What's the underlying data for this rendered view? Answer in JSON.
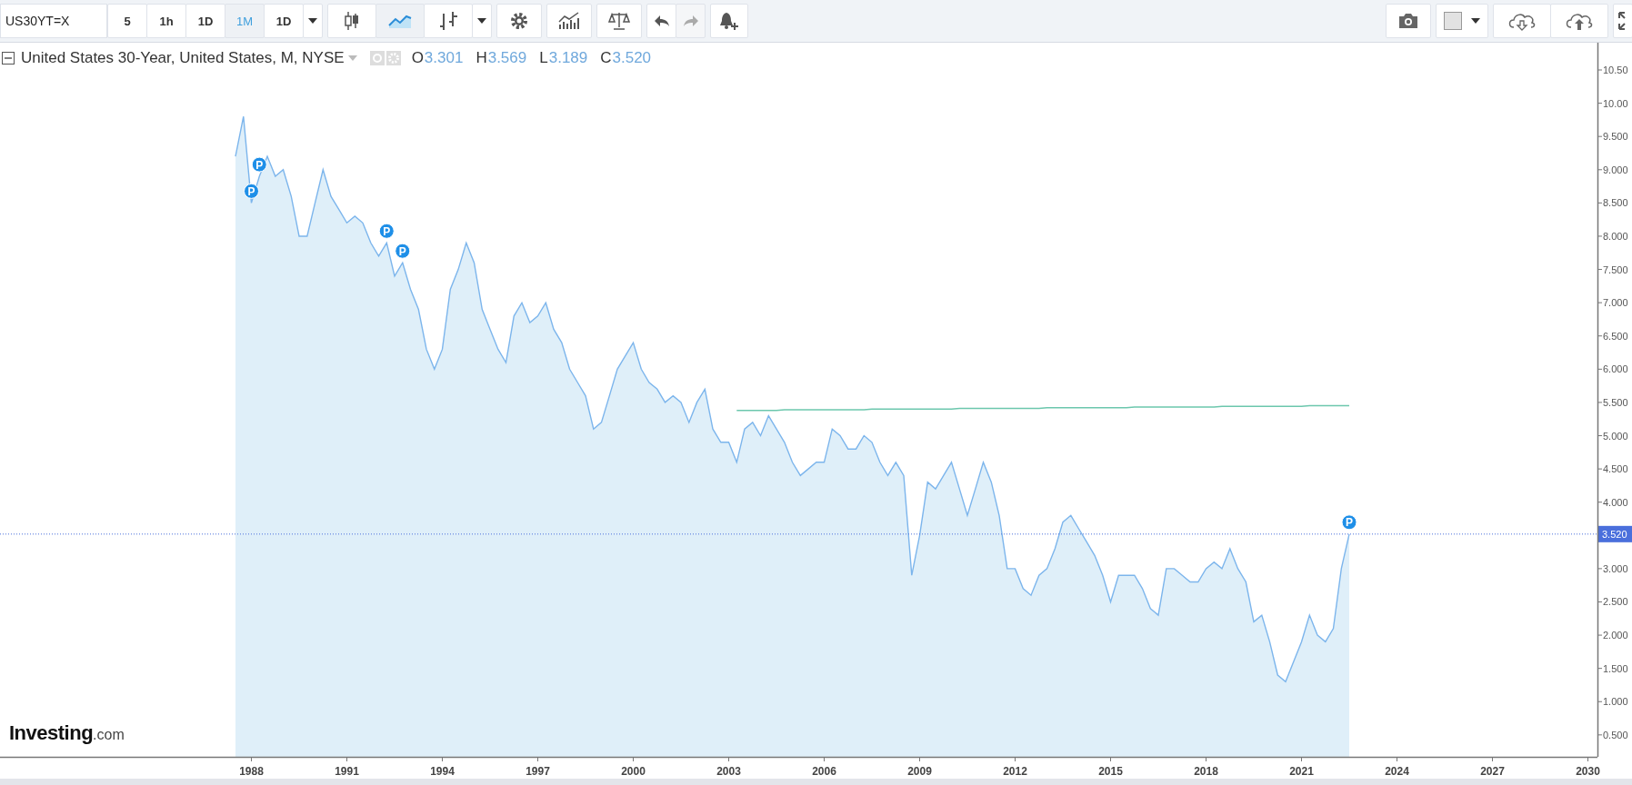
{
  "toolbar": {
    "symbol": "US30YT=X",
    "intervals": [
      {
        "label": "5",
        "selected": false
      },
      {
        "label": "1h",
        "selected": false
      },
      {
        "label": "1D",
        "selected": false
      },
      {
        "label": "1M",
        "selected": true
      },
      {
        "label": "1D",
        "selected": false
      }
    ],
    "chart_types": [
      {
        "kind": "candles",
        "selected": false
      },
      {
        "kind": "line",
        "selected": true
      },
      {
        "kind": "bars",
        "selected": false
      }
    ]
  },
  "legend": {
    "title": "United States 30-Year, United States, M, NYSE",
    "ohlc": [
      {
        "label": "O",
        "value": "3.301"
      },
      {
        "label": "H",
        "value": "3.569"
      },
      {
        "label": "L",
        "value": "3.189"
      },
      {
        "label": "C",
        "value": "3.520"
      }
    ]
  },
  "logo": {
    "name": "Investing",
    "suffix": ".com"
  },
  "chart_data": {
    "type": "area",
    "x": [
      1987.5,
      1987.75,
      1988,
      1988.25,
      1988.5,
      1988.75,
      1989,
      1989.25,
      1989.5,
      1989.75,
      1990,
      1990.25,
      1990.5,
      1990.75,
      1991,
      1991.25,
      1991.5,
      1991.75,
      1992,
      1992.25,
      1992.5,
      1992.75,
      1993,
      1993.25,
      1993.5,
      1993.75,
      1994,
      1994.25,
      1994.5,
      1994.75,
      1995,
      1995.25,
      1995.5,
      1995.75,
      1996,
      1996.25,
      1996.5,
      1996.75,
      1997,
      1997.25,
      1997.5,
      1997.75,
      1998,
      1998.25,
      1998.5,
      1998.75,
      1999,
      1999.25,
      1999.5,
      1999.75,
      2000,
      2000.25,
      2000.5,
      2000.75,
      2001,
      2001.25,
      2001.5,
      2001.75,
      2002,
      2002.25,
      2002.5,
      2002.75,
      2003,
      2003.25,
      2003.5,
      2003.75,
      2004,
      2004.25,
      2004.5,
      2004.75,
      2005,
      2005.25,
      2005.5,
      2005.75,
      2006,
      2006.25,
      2006.5,
      2006.75,
      2007,
      2007.25,
      2007.5,
      2007.75,
      2008,
      2008.25,
      2008.5,
      2008.75,
      2009,
      2009.25,
      2009.5,
      2009.75,
      2010,
      2010.25,
      2010.5,
      2010.75,
      2011,
      2011.25,
      2011.5,
      2011.75,
      2012,
      2012.25,
      2012.5,
      2012.75,
      2013,
      2013.25,
      2013.5,
      2013.75,
      2014,
      2014.25,
      2014.5,
      2014.75,
      2015,
      2015.25,
      2015.5,
      2015.75,
      2016,
      2016.25,
      2016.5,
      2016.75,
      2017,
      2017.25,
      2017.5,
      2017.75,
      2018,
      2018.25,
      2018.5,
      2018.75,
      2019,
      2019.25,
      2019.5,
      2019.75,
      2020,
      2020.25,
      2020.5,
      2020.75,
      2021,
      2021.25,
      2021.5,
      2021.75,
      2022,
      2022.25,
      2022.5
    ],
    "series": [
      {
        "color": "#7cb5ec",
        "values": [
          9.2,
          9.8,
          8.5,
          8.9,
          9.2,
          8.9,
          9.0,
          8.6,
          8.0,
          8.0,
          8.5,
          9.0,
          8.6,
          8.4,
          8.2,
          8.3,
          8.2,
          7.9,
          7.7,
          7.9,
          7.4,
          7.6,
          7.2,
          6.9,
          6.3,
          6.0,
          6.3,
          7.2,
          7.5,
          7.9,
          7.6,
          6.9,
          6.6,
          6.3,
          6.1,
          6.8,
          7.0,
          6.7,
          6.8,
          7.0,
          6.6,
          6.4,
          6.0,
          5.8,
          5.6,
          5.1,
          5.2,
          5.6,
          6.0,
          6.2,
          6.4,
          6.0,
          5.8,
          5.7,
          5.5,
          5.6,
          5.5,
          5.2,
          5.5,
          5.7,
          5.1,
          4.9,
          4.9,
          4.6,
          5.1,
          5.2,
          5.0,
          5.3,
          5.1,
          4.9,
          4.6,
          4.4,
          4.5,
          4.6,
          4.6,
          5.1,
          5.0,
          4.8,
          4.8,
          5.0,
          4.9,
          4.6,
          4.4,
          4.6,
          4.4,
          2.9,
          3.5,
          4.3,
          4.2,
          4.4,
          4.6,
          4.2,
          3.8,
          4.2,
          4.6,
          4.3,
          3.8,
          3.0,
          3.0,
          2.7,
          2.6,
          2.9,
          3.0,
          3.3,
          3.7,
          3.8,
          3.6,
          3.4,
          3.2,
          2.9,
          2.5,
          2.9,
          2.9,
          2.9,
          2.7,
          2.4,
          2.3,
          3.0,
          3.0,
          2.9,
          2.8,
          2.8,
          3.0,
          3.1,
          3.0,
          3.3,
          3.0,
          2.8,
          2.2,
          2.3,
          1.9,
          1.4,
          1.3,
          1.6,
          1.9,
          2.3,
          2.0,
          1.9,
          2.1,
          3.0,
          3.52
        ]
      },
      {
        "type": "line",
        "color": "#6cc7ad",
        "values": [
          null,
          null,
          null,
          null,
          null,
          null,
          null,
          null,
          null,
          null,
          null,
          null,
          null,
          null,
          null,
          null,
          null,
          null,
          null,
          null,
          null,
          null,
          null,
          null,
          null,
          null,
          null,
          null,
          null,
          null,
          null,
          null,
          null,
          null,
          null,
          null,
          null,
          null,
          null,
          null,
          null,
          null,
          null,
          null,
          null,
          null,
          null,
          null,
          null,
          null,
          null,
          null,
          null,
          null,
          null,
          null,
          null,
          null,
          null,
          null,
          null,
          null,
          null,
          5.38,
          5.38,
          5.38,
          5.38,
          5.38,
          5.38,
          5.39,
          5.39,
          5.39,
          5.39,
          5.39,
          5.39,
          5.39,
          5.39,
          5.39,
          5.39,
          5.39,
          5.4,
          5.4,
          5.4,
          5.4,
          5.4,
          5.4,
          5.4,
          5.4,
          5.4,
          5.4,
          5.4,
          5.41,
          5.41,
          5.41,
          5.41,
          5.41,
          5.41,
          5.41,
          5.41,
          5.41,
          5.41,
          5.41,
          5.42,
          5.42,
          5.42,
          5.42,
          5.42,
          5.42,
          5.42,
          5.42,
          5.42,
          5.42,
          5.42,
          5.43,
          5.43,
          5.43,
          5.43,
          5.43,
          5.43,
          5.43,
          5.43,
          5.43,
          5.43,
          5.43,
          5.44,
          5.44,
          5.44,
          5.44,
          5.44,
          5.44,
          5.44,
          5.44,
          5.44,
          5.44,
          5.44,
          5.45,
          5.45,
          5.45,
          5.45,
          5.45,
          5.45
        ]
      }
    ],
    "xlim": [
      1980.1,
      2030.3
    ],
    "ylim": [
      0.17,
      10.91
    ],
    "xticks": [
      1988,
      1991,
      1994,
      1997,
      2000,
      2003,
      2006,
      2009,
      2012,
      2015,
      2018,
      2021,
      2024,
      2027,
      2030
    ],
    "yticks": [
      {
        "value": 10.5,
        "label": "10.50"
      },
      {
        "value": 10,
        "label": "10.00"
      },
      {
        "value": 9.5,
        "label": "9.500"
      },
      {
        "value": 9,
        "label": "9.000"
      },
      {
        "value": 8.5,
        "label": "8.500"
      },
      {
        "value": 8,
        "label": "8.000"
      },
      {
        "value": 7.5,
        "label": "7.500"
      },
      {
        "value": 7,
        "label": "7.000"
      },
      {
        "value": 6.5,
        "label": "6.500"
      },
      {
        "value": 6,
        "label": "6.000"
      },
      {
        "value": 5.5,
        "label": "5.500"
      },
      {
        "value": 5,
        "label": "5.000"
      },
      {
        "value": 4.5,
        "label": "4.500"
      },
      {
        "value": 4,
        "label": "4.000"
      },
      {
        "value": 3,
        "label": "3.000"
      },
      {
        "value": 2.5,
        "label": "2.500"
      },
      {
        "value": 2,
        "label": "2.000"
      },
      {
        "value": 1.5,
        "label": "1.500"
      },
      {
        "value": 1,
        "label": "1.000"
      },
      {
        "value": 0.5,
        "label": "0.500"
      }
    ],
    "ref_lines": [
      {
        "axis": "y",
        "value": 3.52,
        "label": "3.520"
      }
    ],
    "annotations": [
      {
        "x": 1988,
        "y": 8.5,
        "text": "P"
      },
      {
        "x": 1988.25,
        "y": 8.9,
        "text": "P"
      },
      {
        "x": 1992.25,
        "y": 7.9,
        "text": "P"
      },
      {
        "x": 1992.75,
        "y": 7.6,
        "text": "P"
      },
      {
        "x": 2022.5,
        "y": 3.52,
        "text": "P"
      }
    ]
  }
}
